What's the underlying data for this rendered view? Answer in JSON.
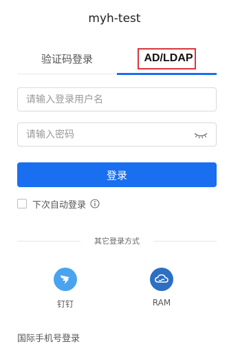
{
  "app": {
    "title": "myh-test"
  },
  "tabs": [
    {
      "label": "验证码登录",
      "active": false
    },
    {
      "label": "AD/LDAP",
      "active": true
    }
  ],
  "form": {
    "username_placeholder": "请输入登录用户名",
    "password_placeholder": "请输入密码",
    "login_label": "登录",
    "remember_label": "下次自动登录",
    "remember_checked": false
  },
  "divider": {
    "label": "其它登录方式"
  },
  "alt_logins": [
    {
      "label": "钉钉",
      "icon": "dingtalk-icon",
      "color": "#4aa3ef"
    },
    {
      "label": "RAM",
      "icon": "cloud-icon",
      "color": "#2d6fc2"
    }
  ],
  "footer": {
    "intl_label": "国际手机号登录"
  },
  "colors": {
    "accent": "#1a6ef0",
    "highlight_border": "#d9343a"
  }
}
